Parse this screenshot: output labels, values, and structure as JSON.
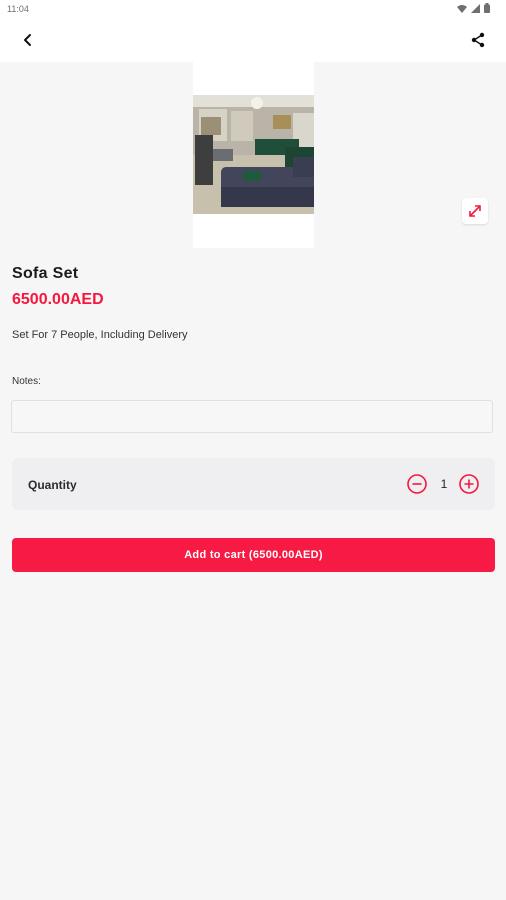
{
  "status_bar": {
    "time": "11:04",
    "icons": [
      "wifi-icon",
      "signal-icon",
      "battery-icon"
    ]
  },
  "toolbar": {
    "back_icon": "chevron-left-icon",
    "share_icon": "share-icon"
  },
  "product": {
    "name": "Sofa Set",
    "price": "6500.00AED",
    "description": "Set For 7 People, Including Delivery",
    "image_icon": "product-photo",
    "expand_icon": "expand-icon"
  },
  "notes": {
    "label": "Notes:",
    "value": "",
    "placeholder": ""
  },
  "quantity": {
    "label": "Quantity",
    "value": "1"
  },
  "cart": {
    "button_label": "Add to cart (6500.00AED)"
  },
  "colors": {
    "accent": "#f71a44",
    "price": "#f5173f",
    "background": "#f6f6f6",
    "card": "#efeff1"
  }
}
